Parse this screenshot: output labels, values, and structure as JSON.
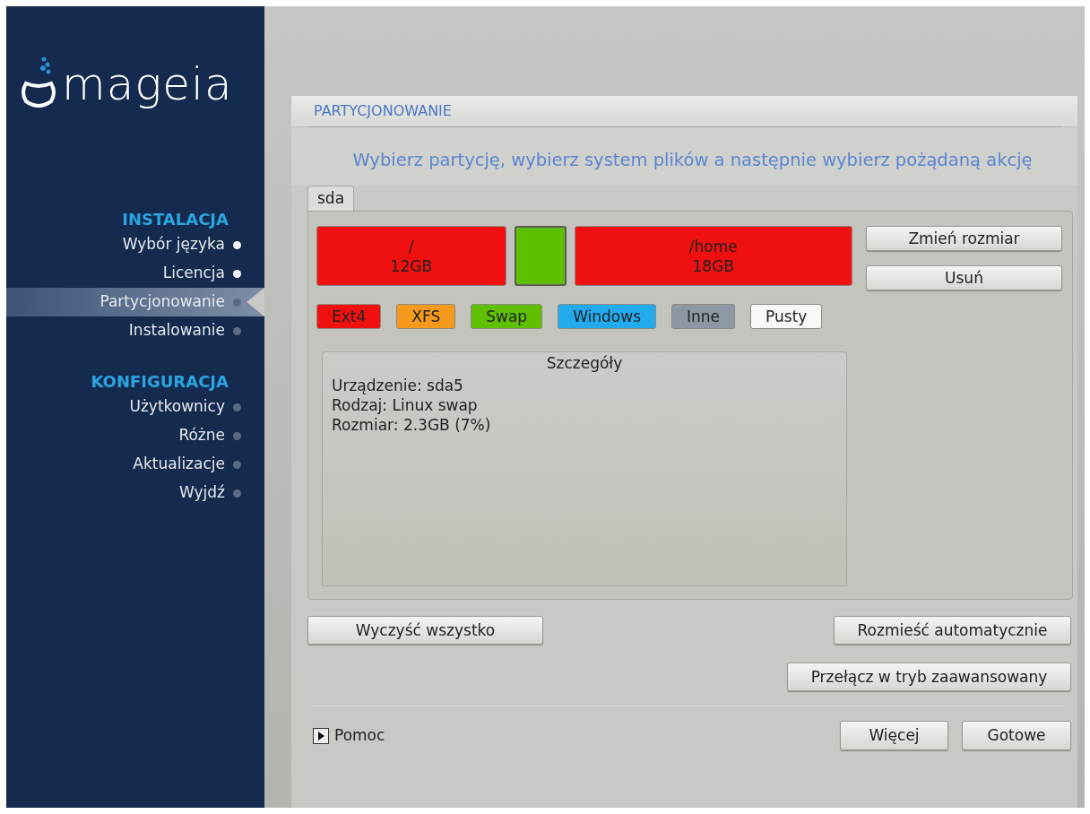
{
  "logo": {
    "text": "mageia"
  },
  "sidebar": {
    "sections": [
      {
        "title": "INSTALACJA",
        "items": [
          {
            "label": "Wybór języka",
            "done": true,
            "selected": false
          },
          {
            "label": "Licencja",
            "done": true,
            "selected": false
          },
          {
            "label": "Partycjonowanie",
            "done": false,
            "selected": true
          },
          {
            "label": "Instalowanie",
            "done": false,
            "selected": false
          }
        ]
      },
      {
        "title": "KONFIGURACJA",
        "items": [
          {
            "label": "Użytkownicy",
            "done": false,
            "selected": false
          },
          {
            "label": "Różne",
            "done": false,
            "selected": false
          },
          {
            "label": "Aktualizacje",
            "done": false,
            "selected": false
          },
          {
            "label": "Wyjdź",
            "done": false,
            "selected": false
          }
        ]
      }
    ]
  },
  "header": {
    "title": "PARTYCJONOWANIE",
    "instruction": "Wybierz partycję, wybierz system plików a następnie wybierz pożądaną akcję"
  },
  "tabs": [
    {
      "label": "sda",
      "selected": true
    }
  ],
  "partitions": [
    {
      "mount": "/",
      "size": "12GB",
      "color": "#f01010",
      "selected": false
    },
    {
      "color": "#5fc000",
      "selected": true
    },
    {
      "mount": "/home",
      "size": "18GB",
      "color": "#f01010",
      "selected": false
    }
  ],
  "partition_actions": [
    "Zmień rozmiar",
    "Usuń"
  ],
  "legend": [
    {
      "label": "Ext4",
      "color": "#f01010"
    },
    {
      "label": "XFS",
      "color": "#f59a1c"
    },
    {
      "label": "Swap",
      "color": "#5fc000"
    },
    {
      "label": "Windows",
      "color": "#22aaee"
    },
    {
      "label": "Inne",
      "color": "#8e98a2"
    },
    {
      "label": "Pusty",
      "color": "#f8f8f6"
    }
  ],
  "details": {
    "title": "Szczegóły",
    "lines": [
      "Urządzenie: sda5",
      "Rodzaj: Linux swap",
      "Rozmiar: 2.3GB (7%)"
    ]
  },
  "buttons": {
    "clear": "Wyczyść wszystko",
    "auto": "Rozmieść automatycznie",
    "advanced": "Przełącz w tryb zaawansowany",
    "help": "Pomoc",
    "more": "Więcej",
    "done": "Gotowe"
  }
}
